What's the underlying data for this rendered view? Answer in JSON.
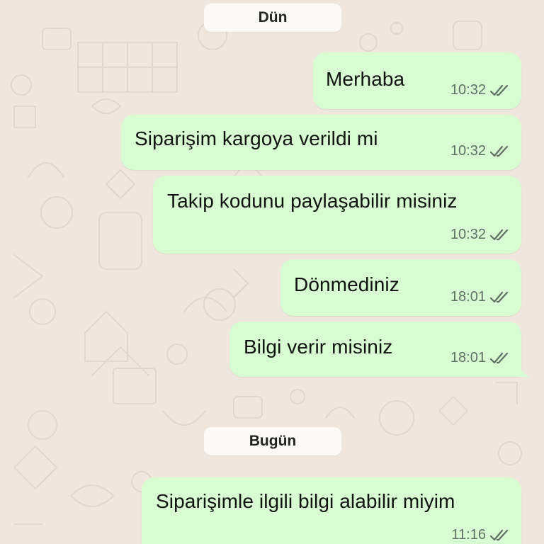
{
  "colors": {
    "background": "#efe7de",
    "outgoing_bubble": "#d9fdd3",
    "date_chip": "#fbfaf7",
    "meta_text": "#5f6d65"
  },
  "dates": {
    "yesterday": "Dün",
    "today": "Bugün"
  },
  "messages": [
    {
      "text": "Merhaba",
      "time": "10:32",
      "status_icon": "double-check-icon"
    },
    {
      "text": "Siparişim kargoya verildi mi",
      "time": "10:32",
      "status_icon": "double-check-icon"
    },
    {
      "text": "Takip kodunu paylaşabilir misiniz",
      "time": "10:32",
      "status_icon": "double-check-icon"
    },
    {
      "text": "Dönmediniz",
      "time": "18:01",
      "status_icon": "double-check-icon"
    },
    {
      "text": "Bilgi verir misiniz",
      "time": "18:01",
      "status_icon": "double-check-icon"
    },
    {
      "text": "Siparişimle ilgili bilgi alabilir miyim",
      "time": "11:16",
      "status_icon": "double-check-icon"
    }
  ]
}
